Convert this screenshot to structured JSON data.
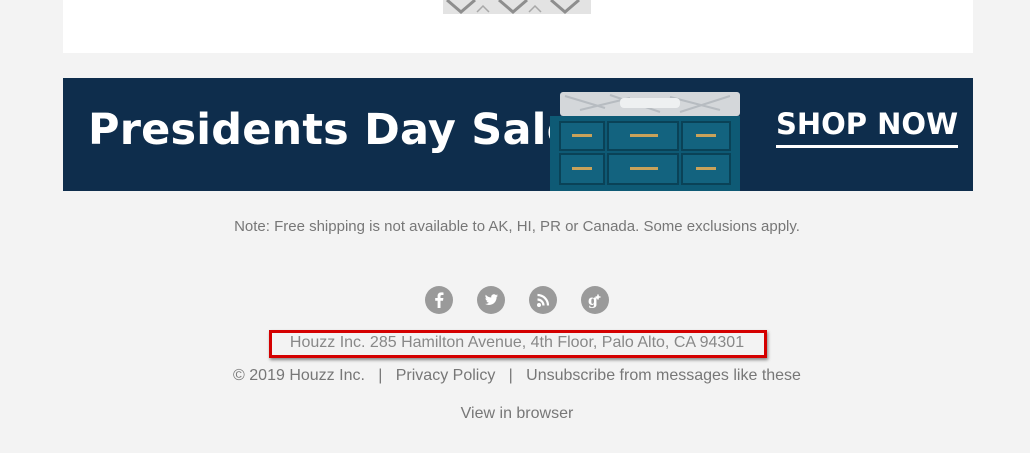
{
  "banner": {
    "title": "Presidents Day Sale",
    "cta": "SHOP NOW",
    "background_color": "#0e2d4c"
  },
  "note": "Note: Free shipping is not available to AK, HI, PR or Canada. Some exclusions apply.",
  "social": {
    "icons": [
      "facebook-icon",
      "twitter-icon",
      "rss-icon",
      "google-plus-icon"
    ]
  },
  "footer": {
    "address": "Houzz Inc. 285 Hamilton Avenue, 4th Floor, Palo Alto, CA 94301",
    "copyright": "© 2019 Houzz Inc.",
    "separator": "|",
    "privacy": "Privacy Policy",
    "unsubscribe": "Unsubscribe from messages like these",
    "view_in_browser": "View in browser"
  },
  "highlight_color": "#d40000"
}
